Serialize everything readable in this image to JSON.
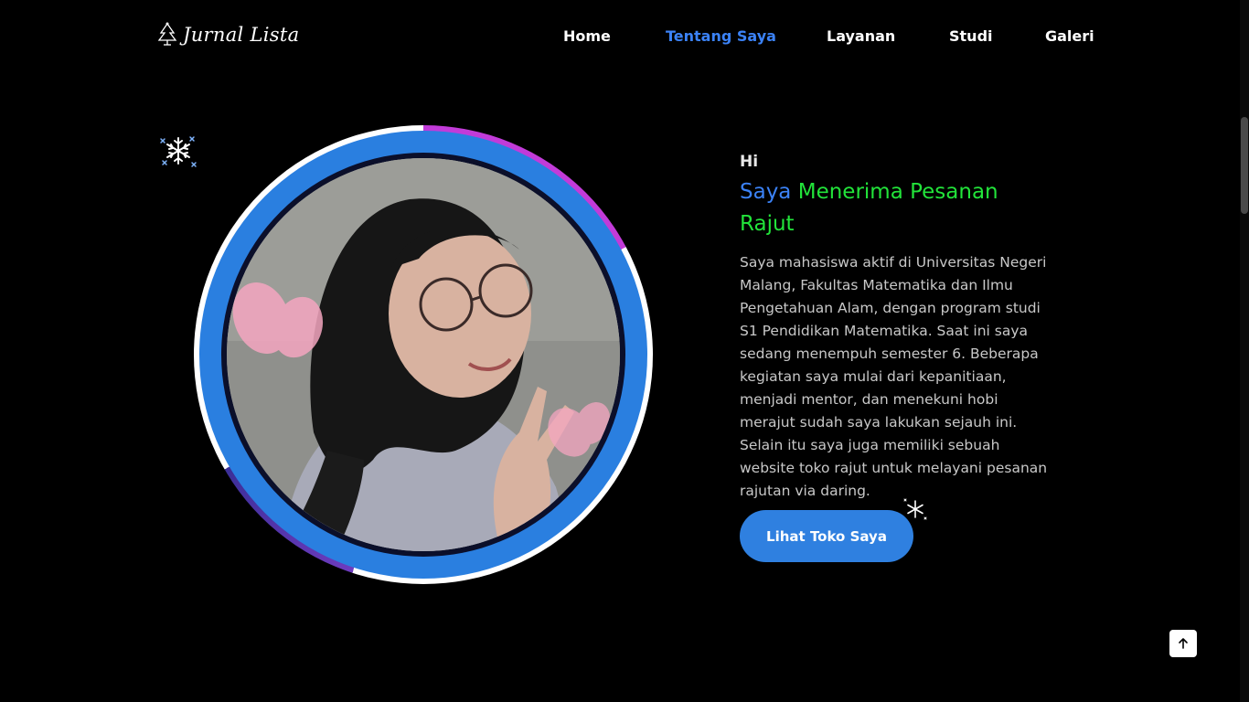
{
  "brand": {
    "name": "Jurnal Lista",
    "logo_icon": "christmas-tree-icon"
  },
  "nav": {
    "items": [
      {
        "label": "Home",
        "active": false
      },
      {
        "label": "Tentang Saya",
        "active": true
      },
      {
        "label": "Layanan",
        "active": false
      },
      {
        "label": "Studi",
        "active": false
      },
      {
        "label": "Galeri",
        "active": false
      }
    ]
  },
  "about": {
    "greeting": "Hi",
    "headline_blue": "Saya",
    "headline_green": "Menerima Pesanan Rajut",
    "description": "Saya mahasiswa aktif di Universitas Negeri Malang, Fakultas Matematika dan Ilmu Pengetahuan Alam, dengan program studi S1 Pendidikan Matematika. Saat ini saya sedang menempuh semester 6. Beberapa kegiatan saya mulai dari kepanitiaan, menjadi mentor, dan menekuni hobi merajut sudah saya lakukan sejauh ini. Selain itu saya juga memiliki sebuah website toko rajut untuk melayani pesanan rajutan via daring.",
    "cta_label": "Lihat Toko Saya"
  },
  "decorations": {
    "snowflake_icon": "snowflake-icon",
    "back_to_top_icon": "arrow-up-icon"
  },
  "colors": {
    "background": "#000000",
    "accent_blue": "#3b82f6",
    "accent_green": "#22e33a",
    "button_blue": "#2f80e0",
    "ring_blue": "#2a7fe0",
    "ring_magenta": "#c23bd9"
  }
}
